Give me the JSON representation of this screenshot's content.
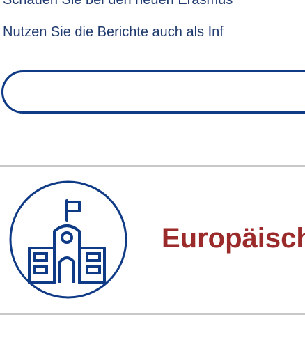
{
  "intro": {
    "line1": "Schauen Sie bei den neuen Erasmus",
    "line2": "Nutzen Sie die Berichte auch als Inf"
  },
  "search": {
    "placeholder": "",
    "value": ""
  },
  "card": {
    "title": "Europäisch",
    "icon": "school-building-icon"
  },
  "colors": {
    "text": "#1f3a6e",
    "accent_blue": "#0f3a85",
    "title_red": "#9b2a2a",
    "divider": "#c8c8c8"
  }
}
